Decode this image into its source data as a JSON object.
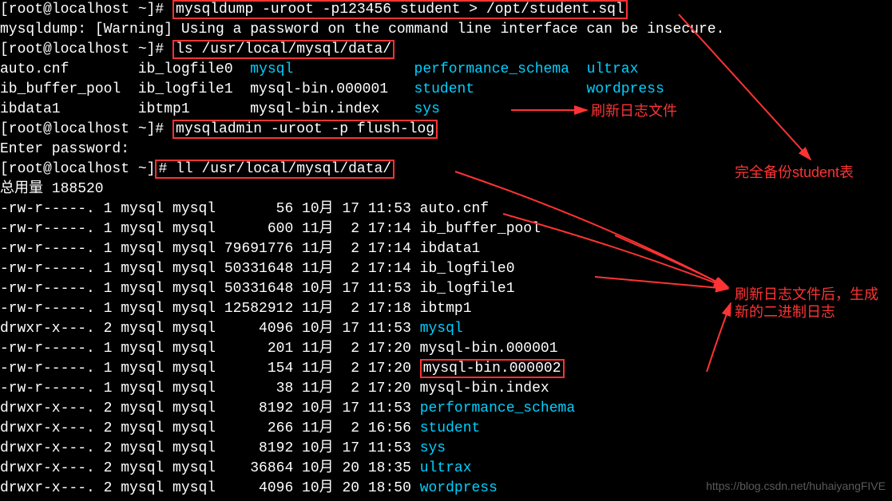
{
  "prompt": "[root@localhost ~]# ",
  "cmd1": "mysqldump -uroot -p123456 student > /opt/student.sql",
  "warn": "mysqldump: [Warning] Using a password on the command line interface can be insecure.",
  "cmd2": "ls /usr/local/mysql/data/",
  "ls_row1": {
    "a": "auto.cnf        ",
    "b": "ib_logfile0  ",
    "c": "mysql",
    "pad1": "              ",
    "d": "performance_schema",
    "pad2": "  ",
    "e": "ultrax"
  },
  "ls_row2": {
    "a": "ib_buffer_pool  ",
    "b": "ib_logfile1  ",
    "c": "mysql-bin.000001   ",
    "d": "student",
    "pad": "             ",
    "e": "wordpress"
  },
  "ls_row3": {
    "a": "ibdata1         ",
    "b": "ibtmp1       ",
    "c": "mysql-bin.index    ",
    "d": "sys"
  },
  "cmd3": "mysqladmin -uroot -p flush-log",
  "enterpw": "Enter password: ",
  "cmd4": "ll /usr/local/mysql/data/",
  "total": "总用量 188520",
  "files": [
    {
      "perm": "-rw-r-----. 1 mysql mysql       56 10月 17 11:53 ",
      "name": "auto.cnf",
      "blue": false
    },
    {
      "perm": "-rw-r-----. 1 mysql mysql      600 11月  2 17:14 ",
      "name": "ib_buffer_pool",
      "blue": false
    },
    {
      "perm": "-rw-r-----. 1 mysql mysql 79691776 11月  2 17:14 ",
      "name": "ibdata1",
      "blue": false
    },
    {
      "perm": "-rw-r-----. 1 mysql mysql 50331648 11月  2 17:14 ",
      "name": "ib_logfile0",
      "blue": false
    },
    {
      "perm": "-rw-r-----. 1 mysql mysql 50331648 10月 17 11:53 ",
      "name": "ib_logfile1",
      "blue": false
    },
    {
      "perm": "-rw-r-----. 1 mysql mysql 12582912 11月  2 17:18 ",
      "name": "ibtmp1",
      "blue": false
    },
    {
      "perm": "drwxr-x---. 2 mysql mysql     4096 10月 17 11:53 ",
      "name": "mysql",
      "blue": true
    },
    {
      "perm": "-rw-r-----. 1 mysql mysql      201 11月  2 17:20 ",
      "name": "mysql-bin.000001",
      "blue": false
    },
    {
      "perm": "-rw-r-----. 1 mysql mysql      154 11月  2 17:20 ",
      "name": "mysql-bin.000002",
      "blue": false,
      "boxed": true
    },
    {
      "perm": "-rw-r-----. 1 mysql mysql       38 11月  2 17:20 ",
      "name": "mysql-bin.index",
      "blue": false
    },
    {
      "perm": "drwxr-x---. 2 mysql mysql     8192 10月 17 11:53 ",
      "name": "performance_schema",
      "blue": true
    },
    {
      "perm": "drwxr-x---. 2 mysql mysql      266 11月  2 16:56 ",
      "name": "student",
      "blue": true
    },
    {
      "perm": "drwxr-x---. 2 mysql mysql     8192 10月 17 11:53 ",
      "name": "sys",
      "blue": true
    },
    {
      "perm": "drwxr-x---. 2 mysql mysql    36864 10月 20 18:35 ",
      "name": "ultrax",
      "blue": true
    },
    {
      "perm": "drwxr-x---. 2 mysql mysql     4096 10月 20 18:50 ",
      "name": "wordpress",
      "blue": true
    }
  ],
  "anno1": "刷新日志文件",
  "anno2": "完全备份student表",
  "anno3": "刷新日志文件后，生成新的二进制日志",
  "watermark": "https://blog.csdn.net/huhaiyangFIVE"
}
